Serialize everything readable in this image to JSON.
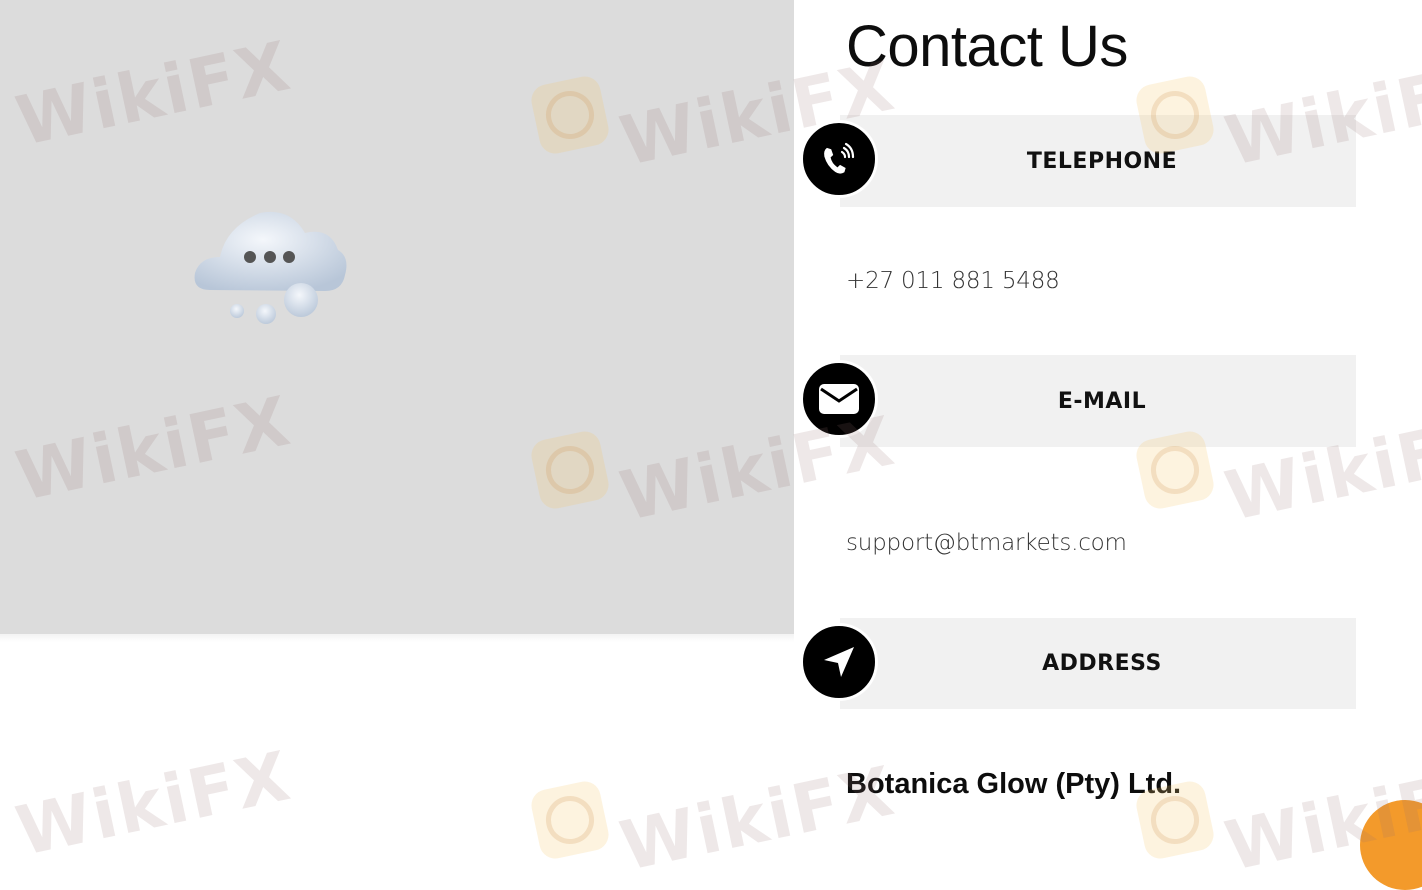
{
  "main": {
    "title": "Contact Us",
    "sections": [
      {
        "heading": "TELEPHONE",
        "icon": "phone-icon",
        "value": "+27 011 881 5488"
      },
      {
        "heading": "E-MAIL",
        "icon": "envelope-icon",
        "value": "support@btmarkets.com"
      },
      {
        "heading": "ADDRESS",
        "icon": "location-arrow-icon",
        "value": "Botanica Glow (Pty) Ltd."
      }
    ]
  },
  "watermark": {
    "text": "WikiFX"
  },
  "colors": {
    "panel": "#dcdcdc",
    "bar": "#f1f1f1",
    "icon_bg": "#000000",
    "chat_bubble": "#f39a2b"
  }
}
